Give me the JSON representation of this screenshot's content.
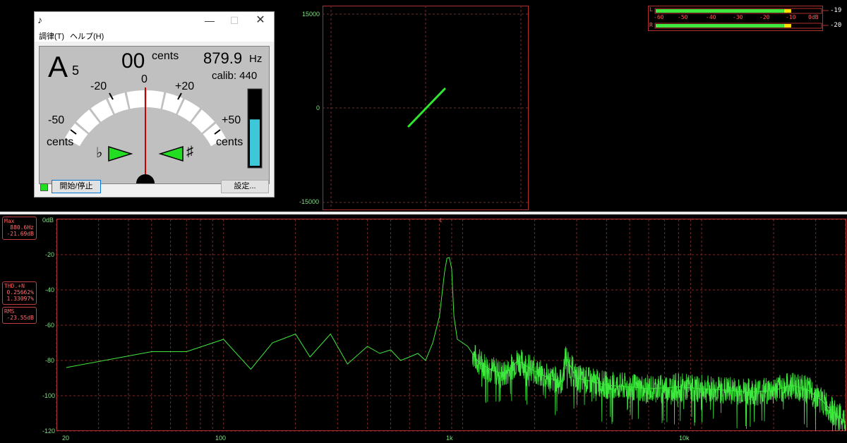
{
  "tuner": {
    "menu": [
      "調律(T)",
      "ヘルプ(H)"
    ],
    "note_letter": "A",
    "note_octave": "5",
    "cents_value": "00",
    "cents_unit": "cents",
    "frequency": "879.9",
    "freq_unit": "Hz",
    "calib": "calib: 440",
    "scale": {
      "m50": "-50",
      "m20": "-20",
      "zero": "0",
      "p20": "+20",
      "p50": "+50",
      "cents_left": "cents",
      "cents_right": "cents"
    },
    "flat_symbol": "♭",
    "sharp_symbol": "♯",
    "level_fraction": 0.62,
    "start_stop_label": "開始/停止",
    "settings_label": "設定...",
    "colors": {
      "arrow": "#22dd22",
      "level": "#3cc8d8",
      "needle": "#cc0000"
    }
  },
  "lissajous": {
    "y_top": "15000",
    "y_mid": "0",
    "y_bottom": "-15000",
    "trace_color": "#2ee82e"
  },
  "level_meter": {
    "ch_left": "L",
    "ch_right": "R",
    "ticks": [
      "-60",
      "-50",
      "-40",
      "-30",
      "-20",
      "-10",
      "0dB"
    ],
    "left_value": "-19",
    "right_value": "-20",
    "left_fraction": 0.82,
    "right_fraction": 0.82
  },
  "spectrum": {
    "y_labels": [
      "0dB",
      "-20",
      "-40",
      "-60",
      "-80",
      "-100",
      "-120"
    ],
    "x_labels": [
      "20",
      "100",
      "1k",
      "10k"
    ],
    "marker_label": "t",
    "max_title": "Max",
    "max_freq": "880.6Hz",
    "max_db": "-21.69dB",
    "thd_title": "THD.+N",
    "thd_val1": "0.25662%",
    "thd_val2": "1.33097%",
    "rms_title": "RMS",
    "rms_val": "-23.55dB",
    "trace_color": "#3ee83e"
  },
  "chart_data": {
    "type": "line",
    "xlabel": "",
    "ylabel": "",
    "x_scale": "log",
    "xlim": [
      20,
      40000
    ],
    "ylim": [
      -120,
      0
    ],
    "grid": true,
    "series": [
      {
        "x": [
          22,
          50,
          70,
          100,
          130,
          160,
          200,
          230,
          280,
          330,
          400,
          450,
          500,
          550,
          600,
          650,
          700,
          750,
          800,
          840,
          860,
          880,
          900,
          920,
          950,
          1000,
          1050,
          1150,
          1300,
          1500,
          1700,
          2000,
          2300,
          2600,
          2700,
          3000,
          3500,
          4000,
          5000,
          6000,
          8000,
          10000,
          13000,
          16000,
          20000,
          24000,
          28000,
          32000,
          36000,
          40000
        ],
        "y": [
          -84,
          -75,
          -75,
          -68,
          -85,
          -70,
          -65,
          -78,
          -65,
          -82,
          -72,
          -76,
          -74,
          -80,
          -78,
          -76,
          -80,
          -70,
          -55,
          -30,
          -22,
          -21.7,
          -28,
          -55,
          -68,
          -70,
          -72,
          -80,
          -85,
          -88,
          -80,
          -86,
          -90,
          -92,
          -78,
          -90,
          -92,
          -94,
          -95,
          -96,
          -95,
          -96,
          -97,
          -98,
          -97,
          -94,
          -97,
          -103,
          -110,
          -115
        ]
      }
    ]
  }
}
